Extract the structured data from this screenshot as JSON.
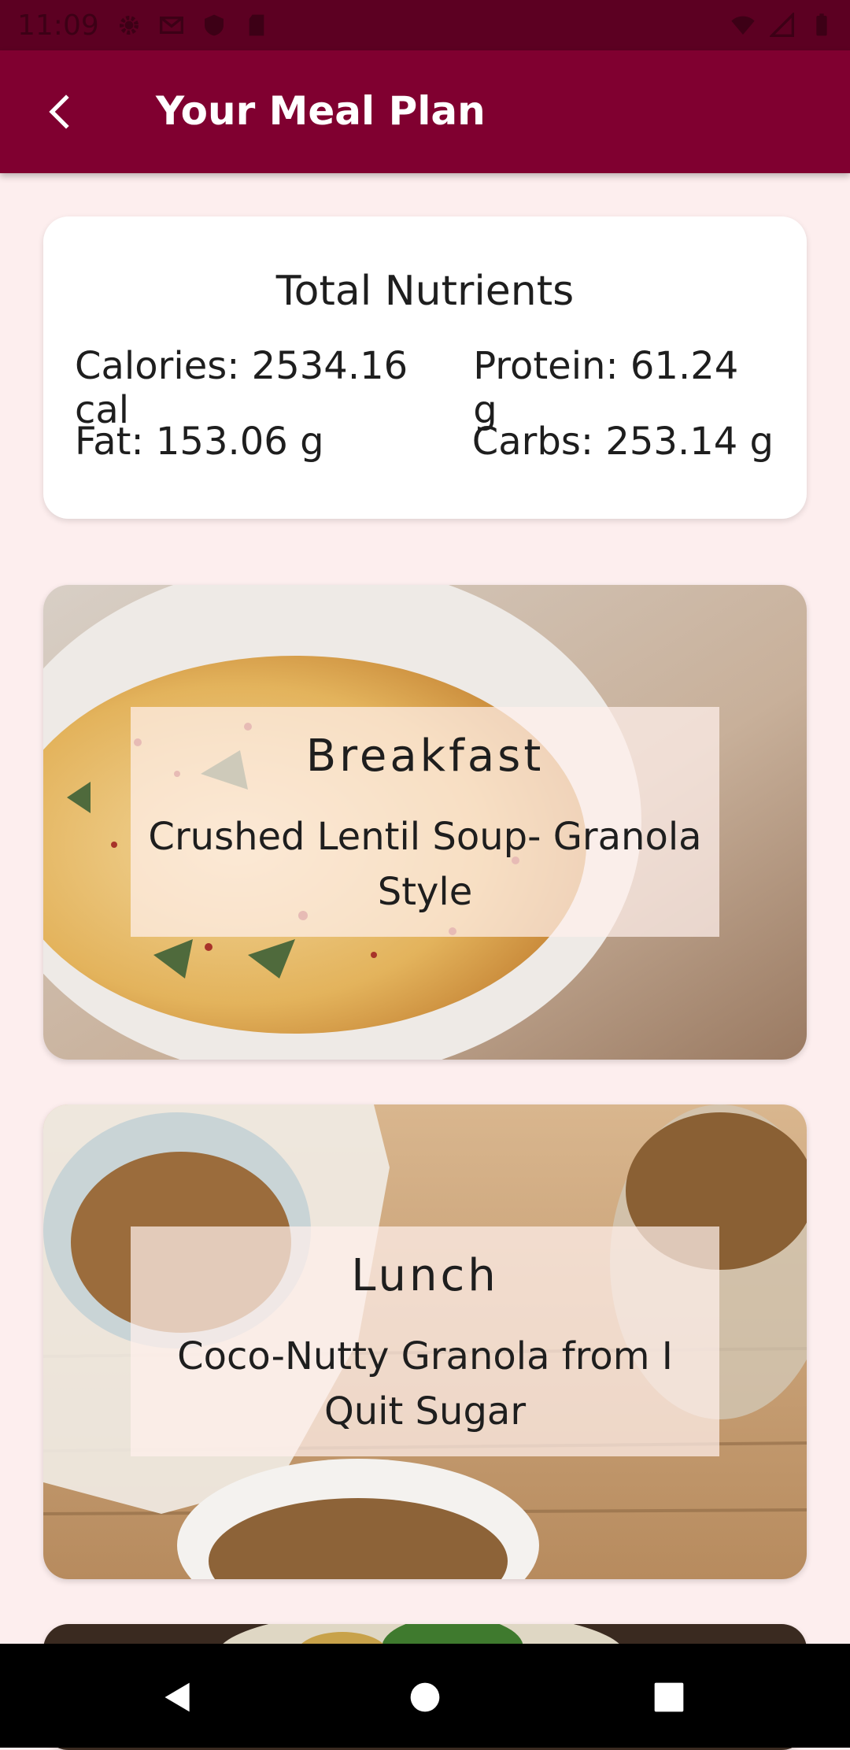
{
  "status_bar": {
    "time": "11:09",
    "left_icons": [
      "gear-icon",
      "gmail-icon",
      "shield-icon",
      "sd-card-icon"
    ],
    "right_icons": [
      "wifi-icon",
      "signal-icon",
      "battery-icon"
    ]
  },
  "app_bar": {
    "title": "Your Meal Plan",
    "back_icon": "arrow-back-icon",
    "color": "#800030"
  },
  "nutrients": {
    "title": "Total Nutrients",
    "calories": "Calories: 2534.16 cal",
    "protein": "Protein: 61.24 g",
    "fat": "Fat: 153.06 g",
    "carbs": "Carbs: 253.14 g"
  },
  "meals": [
    {
      "type": "Breakfast",
      "name": "Crushed Lentil Soup- Granola Style",
      "image": "lentil-soup-photo"
    },
    {
      "type": "Lunch",
      "name": "Coco-Nutty Granola from I Quit Sugar",
      "image": "granola-photo"
    },
    {
      "type": "",
      "name": "",
      "image": "salad-photo"
    }
  ],
  "nav_bar": {
    "icons": [
      "nav-back-icon",
      "nav-home-icon",
      "nav-recents-icon"
    ]
  },
  "colors": {
    "background": "#fdeeee",
    "status_bar": "#5c0022",
    "card": "#ffffff"
  }
}
